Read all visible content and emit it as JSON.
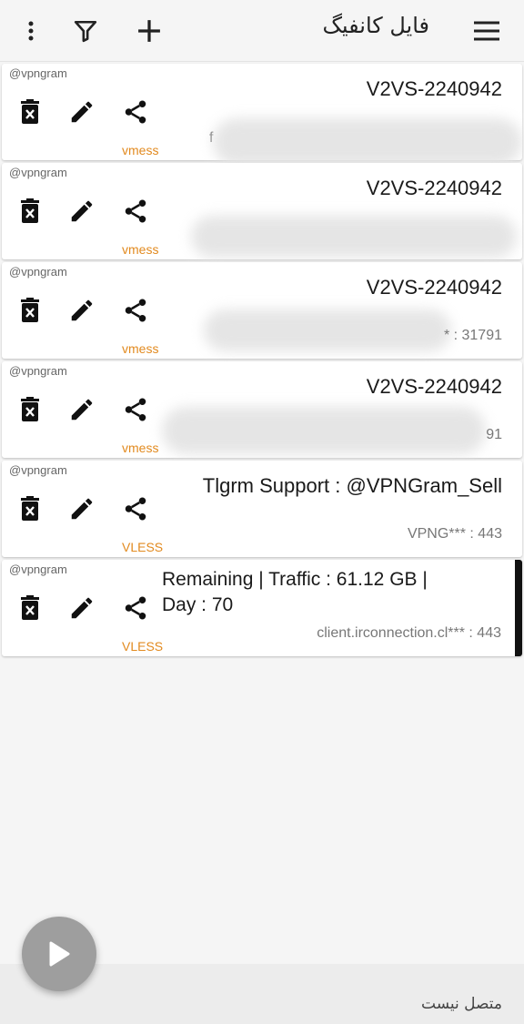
{
  "header": {
    "title": "فایل کانفیگ",
    "icons": [
      "more-vert-icon",
      "filter-icon",
      "add-icon",
      "menu-icon"
    ]
  },
  "servers": [
    {
      "subscription": "@vpngram",
      "remarks": "V2VS-2240942",
      "address": "f",
      "type": "vmess"
    },
    {
      "subscription": "@vpngram",
      "remarks": "V2VS-2240942",
      "address": "",
      "type": "vmess"
    },
    {
      "subscription": "@vpngram",
      "remarks": "V2VS-2240942",
      "address": "* : 31791",
      "type": "vmess"
    },
    {
      "subscription": "@vpngram",
      "remarks": "V2VS-2240942",
      "address": "91",
      "type": "vmess"
    },
    {
      "subscription": "@vpngram",
      "remarks": "Tlgrm Support : @VPNGram_Sell",
      "address": "VPNG*** : 443",
      "type": "VLESS"
    },
    {
      "subscription": "@vpngram",
      "remarks": "Remaining | Traffic : 61.12 GB | Day : 70",
      "address": "client.irconnection.cl*** : 443",
      "type": "VLESS"
    }
  ],
  "status": {
    "text": "متصل نیست"
  },
  "colors": {
    "type_label": "#e28a1f",
    "fab": "#9e9e9e",
    "active_indicator": "#111111"
  }
}
